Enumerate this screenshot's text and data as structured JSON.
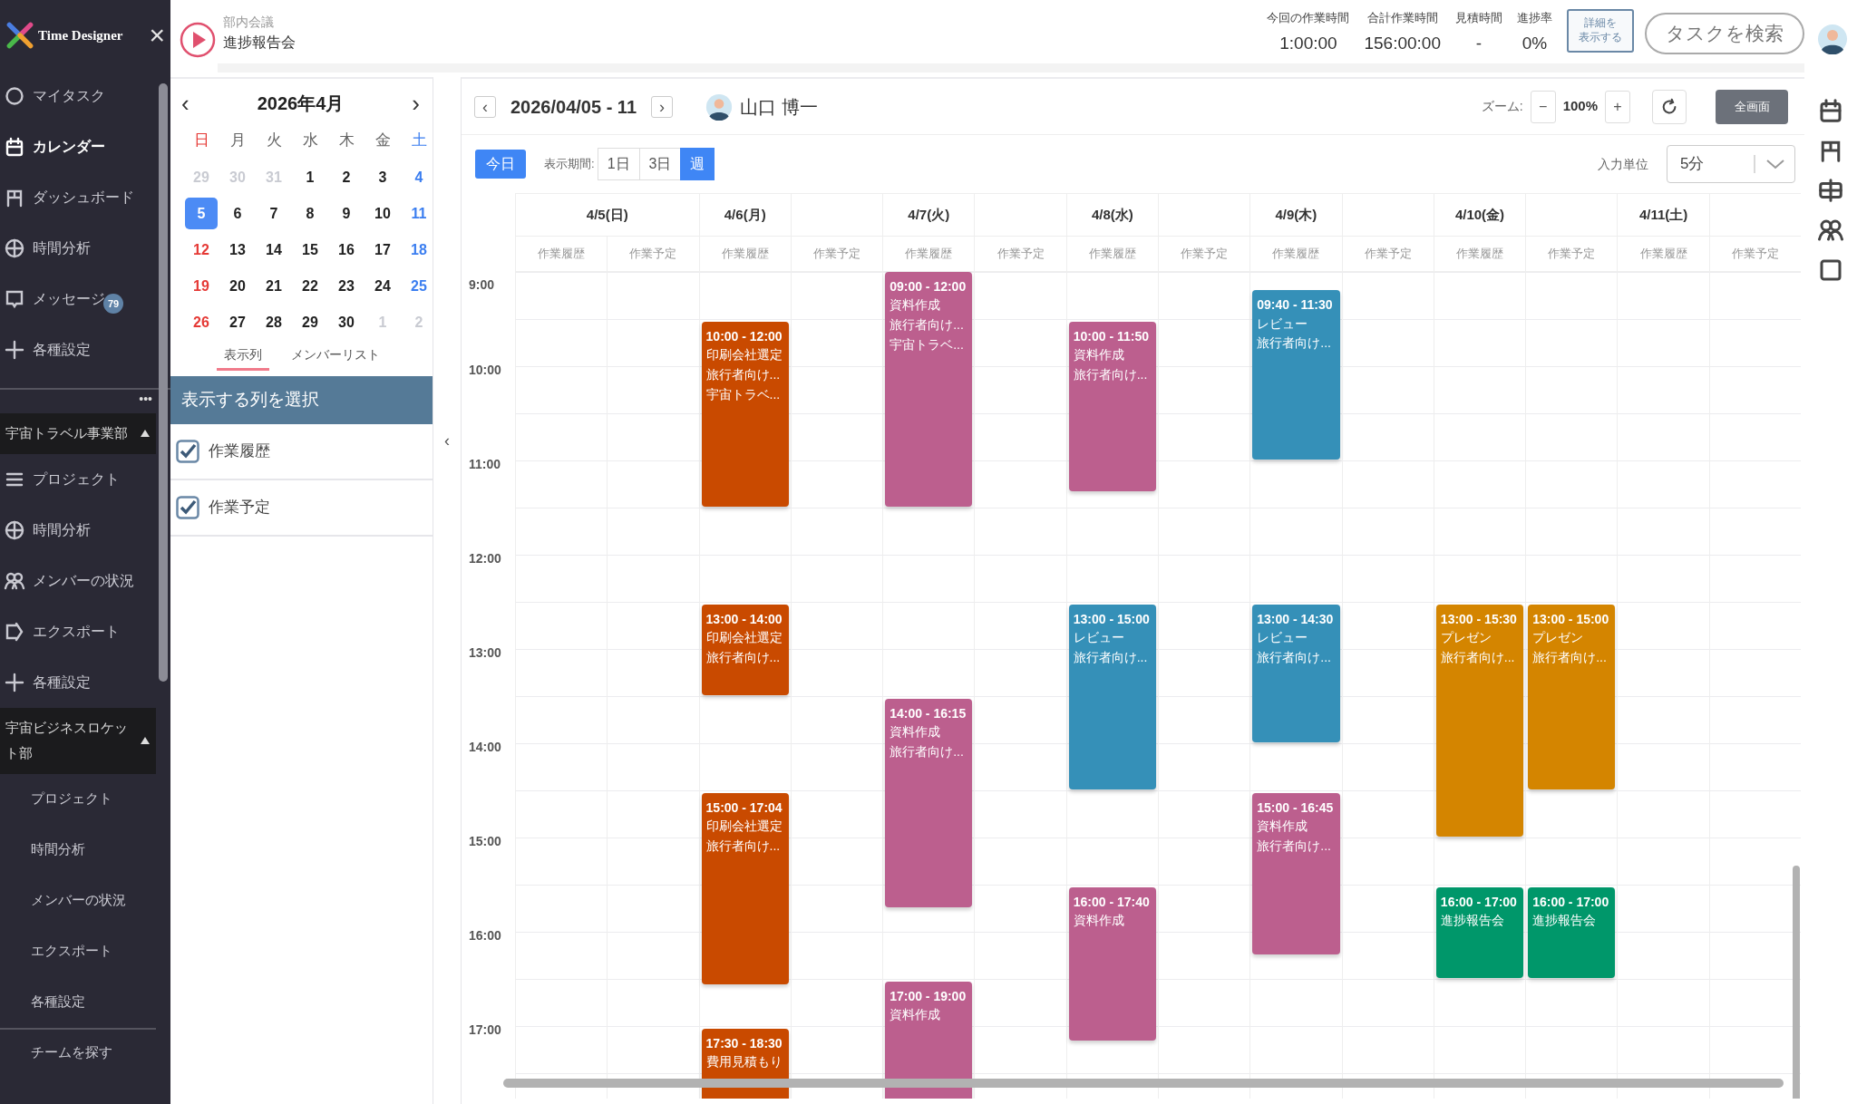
{
  "sidebar": {
    "logo": "Time Designer",
    "close": "×",
    "items": [
      {
        "label": "マイタスク",
        "selected": false
      },
      {
        "label": "カレンダー",
        "selected": true
      },
      {
        "label": "ダッシュボード",
        "selected": false
      },
      {
        "label": "時間分析",
        "selected": false
      },
      {
        "label": "メッセージ",
        "selected": false,
        "badge": "79"
      },
      {
        "label": "各種設定",
        "selected": false
      }
    ],
    "more": "•••",
    "groups": [
      {
        "name": "宇宙トラベル事業部",
        "expanded": true,
        "kind": "icons",
        "items": [
          {
            "label": "プロジェクト"
          },
          {
            "label": "時間分析"
          },
          {
            "label": "メンバーの状況"
          },
          {
            "label": "エクスポート"
          },
          {
            "label": "各種設定"
          }
        ]
      },
      {
        "name": "宇宙ビジネスロケット部",
        "expanded": true,
        "kind": "plain",
        "items": [
          {
            "label": "プロジェクト"
          },
          {
            "label": "時間分析"
          },
          {
            "label": "メンバーの状況"
          },
          {
            "label": "エクスポート"
          },
          {
            "label": "各種設定"
          }
        ]
      }
    ],
    "footer": "チームを探す"
  },
  "task": {
    "category": "部内会議",
    "name": "進捗報告会"
  },
  "stats": [
    {
      "label": "今回の作業時間",
      "value": "1:00:00"
    },
    {
      "label": "合計作業時間",
      "value": "156:00:00"
    },
    {
      "label": "見積時間",
      "value": "-"
    },
    {
      "label": "進捗率",
      "value": "0%"
    }
  ],
  "detail_button": [
    "詳細を",
    "表示する"
  ],
  "search_button": "タスクを検索",
  "mini_calendar": {
    "title": "2026年4月",
    "prev": "‹",
    "next": "›",
    "weekdays": [
      "日",
      "月",
      "火",
      "水",
      "木",
      "金",
      "土"
    ],
    "weeks": [
      [
        {
          "d": "29",
          "muted": true,
          "selected": false
        },
        {
          "d": "30",
          "muted": true,
          "selected": false
        },
        {
          "d": "31",
          "muted": true,
          "selected": false
        },
        {
          "d": "1",
          "muted": false,
          "selected": false
        },
        {
          "d": "2",
          "muted": false,
          "selected": false
        },
        {
          "d": "3",
          "muted": false,
          "selected": false
        },
        {
          "d": "4",
          "muted": false,
          "selected": false
        }
      ],
      [
        {
          "d": "5",
          "muted": false,
          "selected": true
        },
        {
          "d": "6",
          "muted": false,
          "selected": false
        },
        {
          "d": "7",
          "muted": false,
          "selected": false
        },
        {
          "d": "8",
          "muted": false,
          "selected": false
        },
        {
          "d": "9",
          "muted": false,
          "selected": false
        },
        {
          "d": "10",
          "muted": false,
          "selected": false
        },
        {
          "d": "11",
          "muted": false,
          "selected": false
        }
      ],
      [
        {
          "d": "12",
          "muted": false,
          "selected": false
        },
        {
          "d": "13",
          "muted": false,
          "selected": false
        },
        {
          "d": "14",
          "muted": false,
          "selected": false
        },
        {
          "d": "15",
          "muted": false,
          "selected": false
        },
        {
          "d": "16",
          "muted": false,
          "selected": false
        },
        {
          "d": "17",
          "muted": false,
          "selected": false
        },
        {
          "d": "18",
          "muted": false,
          "selected": false
        }
      ],
      [
        {
          "d": "19",
          "muted": false,
          "selected": false
        },
        {
          "d": "20",
          "muted": false,
          "selected": false
        },
        {
          "d": "21",
          "muted": false,
          "selected": false
        },
        {
          "d": "22",
          "muted": false,
          "selected": false
        },
        {
          "d": "23",
          "muted": false,
          "selected": false
        },
        {
          "d": "24",
          "muted": false,
          "selected": false
        },
        {
          "d": "25",
          "muted": false,
          "selected": false
        }
      ],
      [
        {
          "d": "26",
          "muted": false,
          "selected": false
        },
        {
          "d": "27",
          "muted": false,
          "selected": false
        },
        {
          "d": "28",
          "muted": false,
          "selected": false
        },
        {
          "d": "29",
          "muted": false,
          "selected": false
        },
        {
          "d": "30",
          "muted": false,
          "selected": false
        },
        {
          "d": "1",
          "muted": true,
          "selected": false
        },
        {
          "d": "2",
          "muted": true,
          "selected": false
        }
      ]
    ]
  },
  "panel_tabs": [
    {
      "label": "表示列",
      "selected": true
    },
    {
      "label": "メンバーリスト",
      "selected": false
    }
  ],
  "column_picker": {
    "title": "表示する列を選択",
    "options": [
      {
        "label": "作業履歴",
        "checked": true
      },
      {
        "label": "作業予定",
        "checked": true
      }
    ]
  },
  "collapse": "‹",
  "toolbar": {
    "prev": "‹",
    "range": "2026/04/05 - 11",
    "next": "›",
    "user": "山口 博一",
    "zoom_label": "ズーム:",
    "zoom_out": "−",
    "zoom": "100%",
    "zoom_in": "+",
    "fullscreen": "全画面",
    "today": "今日",
    "period_label": "表示期間:",
    "periods": [
      {
        "label": "1日",
        "selected": false
      },
      {
        "label": "3日",
        "selected": false
      },
      {
        "label": "週",
        "selected": true
      }
    ],
    "unit_label": "入力単位",
    "unit": "5分"
  },
  "hours": [
    "9:00",
    "10:00",
    "11:00",
    "12:00",
    "13:00",
    "14:00",
    "15:00",
    "16:00",
    "17:00"
  ],
  "days": [
    {
      "date": "4/5(日)",
      "kind": "merged",
      "columns": [
        "作業履歴",
        "作業予定"
      ]
    },
    {
      "date": "4/6(月)",
      "kind": "split",
      "columns": [
        "作業履歴",
        "作業予定"
      ],
      "history": [
        {
          "time": "10:00 - 12:00",
          "lines": [
            "印刷会社選定",
            "旅行者向け...",
            "宇宙トラベ..."
          ],
          "color": "#c94a00"
        },
        {
          "time": "13:00 - 14:00",
          "lines": [
            "印刷会社選定",
            "旅行者向け..."
          ],
          "color": "#c94a00"
        },
        {
          "time": "15:00 - 17:04",
          "lines": [
            "印刷会社選定",
            "旅行者向け..."
          ],
          "color": "#c94a00"
        },
        {
          "time": "17:30 - 18:30",
          "lines": [
            "費用見積もり"
          ],
          "color": "#c94a00"
        }
      ]
    },
    {
      "date": "4/7(火)",
      "kind": "split",
      "columns": [
        "作業履歴",
        "作業予定"
      ],
      "history": [
        {
          "time": "09:00 - 12:00",
          "lines": [
            "資料作成",
            "旅行者向け...",
            "宇宙トラベ..."
          ],
          "color": "#bc5f8e"
        },
        {
          "time": "14:00 - 16:15",
          "lines": [
            "資料作成",
            "旅行者向け..."
          ],
          "color": "#bc5f8e"
        },
        {
          "time": "17:00 - 19:00",
          "lines": [
            "資料作成"
          ],
          "color": "#bc5f8e"
        }
      ]
    },
    {
      "date": "4/8(水)",
      "kind": "split",
      "columns": [
        "作業履歴",
        "作業予定"
      ],
      "history": [
        {
          "time": "10:00 - 11:50",
          "lines": [
            "資料作成",
            "旅行者向け..."
          ],
          "color": "#bc5f8e"
        },
        {
          "time": "13:00 - 15:00",
          "lines": [
            "レビュー",
            "旅行者向け..."
          ],
          "color": "#3590b8"
        },
        {
          "time": "16:00 - 17:40",
          "lines": [
            "資料作成"
          ],
          "color": "#bc5f8e"
        }
      ]
    },
    {
      "date": "4/9(木)",
      "kind": "split",
      "columns": [
        "作業履歴",
        "作業予定"
      ],
      "history": [
        {
          "time": "09:40 - 11:30",
          "lines": [
            "レビュー",
            "旅行者向け..."
          ],
          "color": "#3590b8"
        },
        {
          "time": "13:00 - 14:30",
          "lines": [
            "レビュー",
            "旅行者向け..."
          ],
          "color": "#3590b8"
        },
        {
          "time": "15:00 - 16:45",
          "lines": [
            "資料作成",
            "旅行者向け..."
          ],
          "color": "#bc5f8e"
        }
      ]
    },
    {
      "date": "4/10(金)",
      "kind": "split",
      "columns": [
        "作業履歴",
        "作業予定"
      ],
      "history": [
        {
          "time": "13:00 - 15:30",
          "lines": [
            "プレゼン",
            "旅行者向け..."
          ],
          "color": "#d48500"
        },
        {
          "time": "16:00 - 17:00",
          "lines": [
            "進捗報告会"
          ],
          "color": "#00976a"
        }
      ],
      "plan": [
        {
          "time": "13:00 - 15:00",
          "lines": [
            "プレゼン",
            "旅行者向け..."
          ],
          "color": "#d48500"
        },
        {
          "time": "16:00 - 17:00",
          "lines": [
            "進捗報告会"
          ],
          "color": "#00976a"
        }
      ]
    },
    {
      "date": "4/11(土)",
      "kind": "split",
      "columns": [
        "作業履歴",
        "作業予定"
      ]
    }
  ]
}
